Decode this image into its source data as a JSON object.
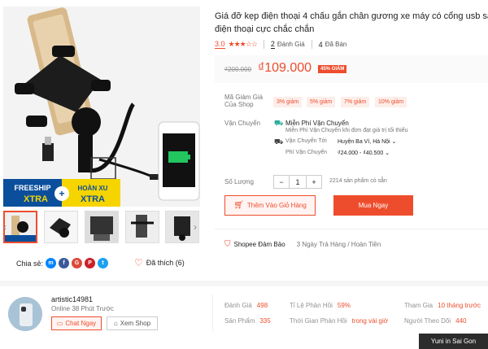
{
  "product": {
    "title_line1": "Giá đỡ kẹp điện thoại 4 chấu gắn chân gương xe máy có cổng usb sạc",
    "title_line2": "điện thoại cực chắc chắn",
    "rating_value": "3.0",
    "rating_stars": 3,
    "reviews_count": "2",
    "reviews_label": "Đánh Giá",
    "sold_count": "4",
    "sold_label": "Đã Bán",
    "old_price": "₫200.000",
    "price": "₫109.000",
    "discount": "45% GIẢM"
  },
  "image": {
    "freeship": "FREESHIP",
    "xtra1": "XTRA",
    "plus": "+",
    "hoanxu": "HOÀN XU",
    "xtra2": "XTRA"
  },
  "share": {
    "label": "Chia sẻ:"
  },
  "like": {
    "label": "Đã thích (6)"
  },
  "vouchers": {
    "label": "Mã Giảm Giá Của Shop",
    "items": [
      "3% giảm",
      "5% giảm",
      "7% giảm",
      "10% giảm"
    ]
  },
  "shipping": {
    "label": "Vận Chuyển",
    "free_title": "Miễn Phí Vận Chuyển",
    "free_sub": "Miễn Phí Vận Chuyển khi đơn đạt giá trị tối thiểu",
    "to_label": "Vận Chuyển Tới",
    "to_value": "Huyện Ba Vì, Hà Nội",
    "fee_label": "Phí Vận Chuyển",
    "fee_value": "₫24.000 - ₫40.500"
  },
  "quantity": {
    "label": "Số Lượng",
    "value": "1",
    "minus": "−",
    "plus": "+",
    "stock": "2214 sản phẩm có sẵn"
  },
  "buttons": {
    "add_cart": "Thêm Vào Giỏ Hàng",
    "buy_now": "Mua Ngay"
  },
  "guarantee": {
    "title": "Shopee Đảm Bảo",
    "desc": "3 Ngày Trả Hàng / Hoàn Tiền"
  },
  "shop": {
    "name": "artistic14981",
    "online": "Online 38 Phút Trước",
    "chat": "Chat Ngay",
    "view": "Xem Shop",
    "stats": [
      {
        "label": "Đánh Giá",
        "value": "498"
      },
      {
        "label": "Tỉ Lệ Phản Hồi",
        "value": "59%"
      },
      {
        "label": "Tham Gia",
        "value": "10 tháng trước"
      },
      {
        "label": "Sản Phẩm",
        "value": "335"
      },
      {
        "label": "Thời Gian Phản Hồi",
        "value": "trong vài giờ"
      },
      {
        "label": "Người Theo Dõi",
        "value": "440"
      }
    ]
  },
  "watermark": "Yuni in Sai Gon",
  "colors": {
    "accent": "#ee4d2d",
    "rating": "#ee4d2d"
  }
}
